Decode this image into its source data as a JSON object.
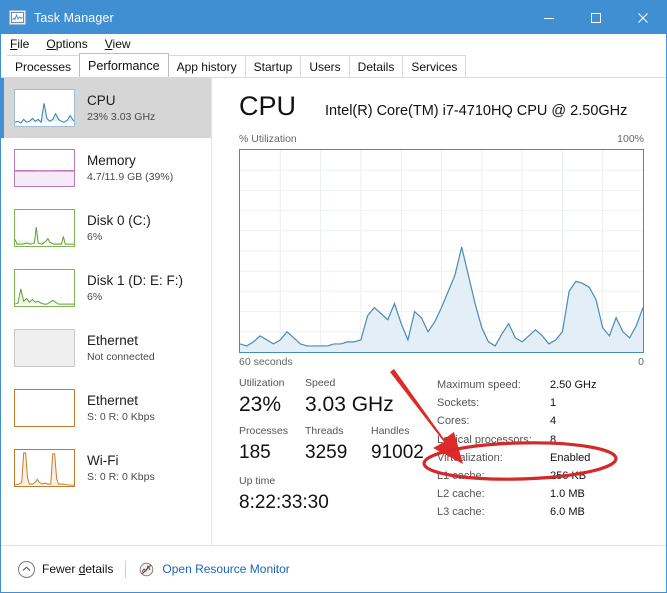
{
  "window": {
    "title": "Task Manager",
    "icon": "task-manager-icon",
    "minimize_label": "—",
    "maximize_label": "□",
    "close_label": "✕"
  },
  "menu": {
    "items": [
      {
        "label": "File",
        "accel": "F"
      },
      {
        "label": "Options",
        "accel": "O"
      },
      {
        "label": "View",
        "accel": "V"
      }
    ]
  },
  "tabs": {
    "selected": "Performance",
    "items": [
      {
        "label": "Processes"
      },
      {
        "label": "Performance"
      },
      {
        "label": "App history"
      },
      {
        "label": "Startup"
      },
      {
        "label": "Users"
      },
      {
        "label": "Details"
      },
      {
        "label": "Services"
      }
    ]
  },
  "sidebar": {
    "items": [
      {
        "title": "CPU",
        "sub": "23%  3.03 GHz",
        "selected": true,
        "color": "#2e7ca8"
      },
      {
        "title": "Memory",
        "sub": "4.7/11.9 GB (39%)",
        "selected": false,
        "color": "#a23fa2"
      },
      {
        "title": "Disk 0 (C:)",
        "sub": "6%",
        "selected": false,
        "color": "#5a9e32"
      },
      {
        "title": "Disk 1 (D: E: F:)",
        "sub": "6%",
        "selected": false,
        "color": "#5a9e32"
      },
      {
        "title": "Ethernet",
        "sub": "Not connected",
        "selected": false,
        "color": "#c07a2a"
      },
      {
        "title": "Ethernet",
        "sub": "S: 0 R: 0 Kbps",
        "selected": false,
        "color": "#c07a2a"
      },
      {
        "title": "Wi-Fi",
        "sub": "S: 0 R: 0 Kbps",
        "selected": false,
        "color": "#c07a2a"
      }
    ]
  },
  "main": {
    "heading": "CPU",
    "model": "Intel(R) Core(TM) i7-4710HQ CPU @ 2.50GHz",
    "graph_label": "% Utilization",
    "graph_max": "100%",
    "graph_duration": "60 seconds",
    "graph_min": "0",
    "stats": {
      "utilization_label": "Utilization",
      "utilization_value": "23%",
      "speed_label": "Speed",
      "speed_value": "3.03 GHz",
      "processes_label": "Processes",
      "processes_value": "185",
      "threads_label": "Threads",
      "threads_value": "3259",
      "handles_label": "Handles",
      "handles_value": "91002",
      "uptime_label": "Up time",
      "uptime_value": "8:22:33:30"
    },
    "details": [
      {
        "label": "Maximum speed:",
        "value": "2.50 GHz"
      },
      {
        "label": "Sockets:",
        "value": "1"
      },
      {
        "label": "Cores:",
        "value": "4"
      },
      {
        "label": "Logical processors:",
        "value": "8"
      },
      {
        "label": "Virtualization:",
        "value": "Enabled"
      },
      {
        "label": "L1 cache:",
        "value": "256 KB"
      },
      {
        "label": "L2 cache:",
        "value": "1.0 MB"
      },
      {
        "label": "L3 cache:",
        "value": "6.0 MB"
      }
    ]
  },
  "footer": {
    "fewer_details": "Fewer details",
    "fewer_details_accel": "d",
    "open_resource_monitor": "Open Resource Monitor"
  },
  "annotation": {
    "color": "#e02a2a",
    "arrow_name": "red-arrow-annotation",
    "ellipse_name": "red-ellipse-annotation",
    "highlights": "Virtualization: Enabled"
  },
  "theme": {
    "titlebar": "#3f8fd2",
    "accent": "#3f8fd2",
    "graph_line": "#4a8bb5",
    "graph_fill": "#e3eef6",
    "link": "#1b66b5",
    "selected_row": "#d6d6d6"
  },
  "chart_data": {
    "type": "area",
    "title": "% Utilization",
    "xlabel": "60 seconds",
    "ylabel": "% Utilization",
    "ylim": [
      0,
      100
    ],
    "grid": true,
    "legend": "none",
    "x": [
      0,
      1,
      2,
      3,
      4,
      5,
      6,
      7,
      8,
      9,
      10,
      11,
      12,
      13,
      14,
      15,
      16,
      17,
      18,
      19,
      20,
      21,
      22,
      23,
      24,
      25,
      26,
      27,
      28,
      29,
      30,
      31,
      32,
      33,
      34,
      35,
      36,
      37,
      38,
      39,
      40,
      41,
      42,
      43,
      44,
      45,
      46,
      47,
      48,
      49,
      50,
      51,
      52,
      53,
      54,
      55,
      56,
      57,
      58,
      59
    ],
    "values": [
      4,
      3,
      5,
      8,
      6,
      4,
      6,
      10,
      7,
      4,
      3,
      3,
      3,
      3,
      4,
      4,
      5,
      5,
      6,
      18,
      22,
      19,
      16,
      24,
      14,
      6,
      20,
      17,
      10,
      15,
      22,
      30,
      38,
      52,
      38,
      24,
      12,
      5,
      3,
      9,
      14,
      7,
      5,
      8,
      11,
      8,
      4,
      6,
      10,
      30,
      35,
      34,
      32,
      26,
      12,
      8,
      17,
      10,
      7,
      13,
      22
    ]
  }
}
